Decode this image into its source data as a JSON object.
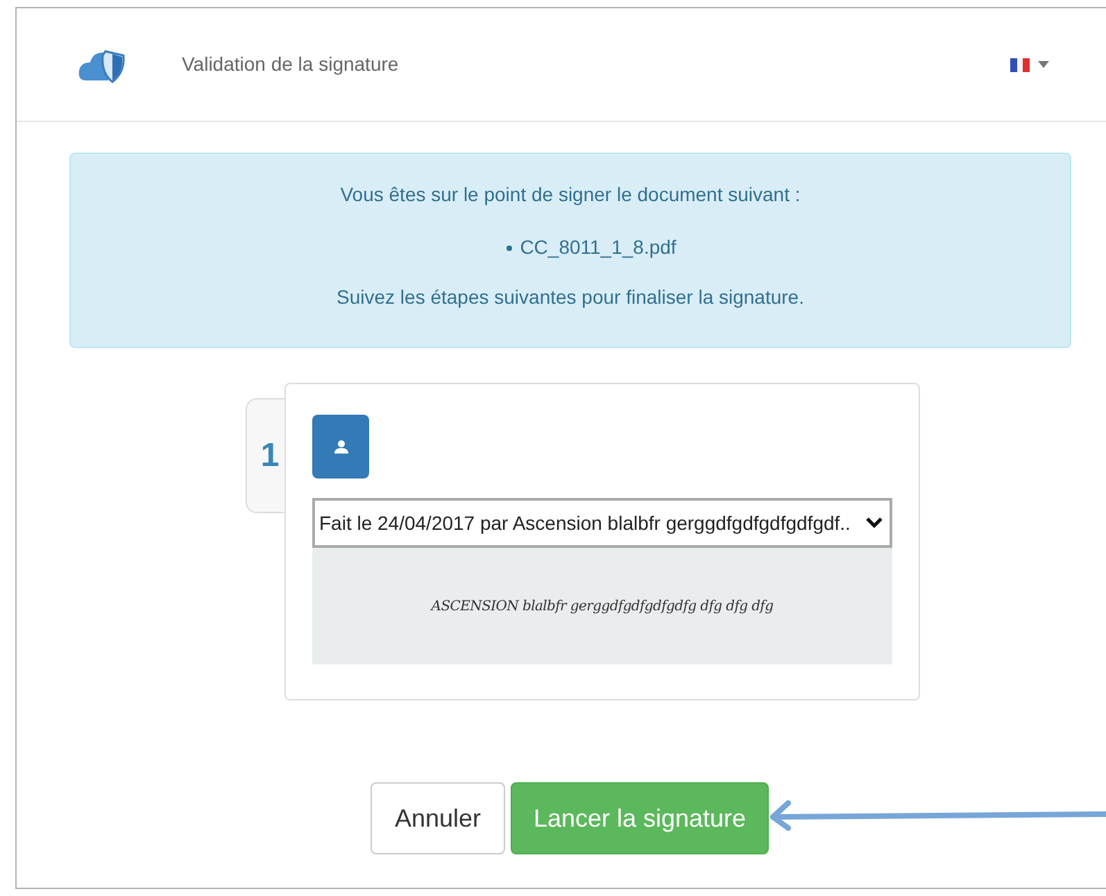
{
  "header": {
    "title": "Validation de la signature"
  },
  "info": {
    "intro": "Vous êtes sur le point de signer le document suivant :",
    "documents": [
      "CC_8011_1_8.pdf"
    ],
    "outro": "Suivez les étapes suivantes pour finaliser la signature."
  },
  "step": {
    "number": "1",
    "mention": {
      "value": "Fait le 24/04/2017 par Ascension blalbfr gerggdfgdfgdfgdfgdf.."
    },
    "signature_text": "ASCENSION blalbfr gerggdfgdfgdfgdfg dfg dfg dfg"
  },
  "buttons": [
    {
      "label": "Annuler",
      "kind": "default"
    },
    {
      "label": "Lancer la signature",
      "kind": "primary"
    }
  ]
}
